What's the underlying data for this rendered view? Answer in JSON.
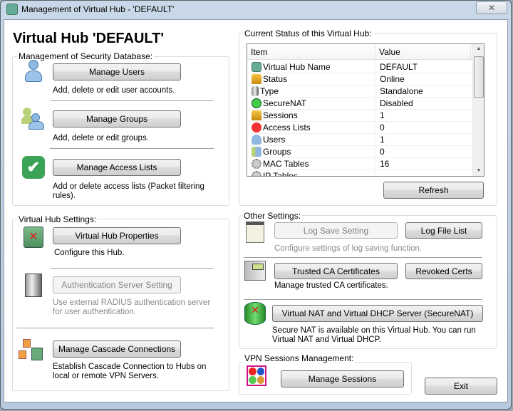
{
  "window": {
    "title": "Management of Virtual Hub - 'DEFAULT'",
    "close_glyph": "✕"
  },
  "hub_title": "Virtual Hub 'DEFAULT'",
  "security": {
    "legend": "Management of Security Database:",
    "users": {
      "button": "Manage Users",
      "desc": "Add, delete or edit user accounts."
    },
    "groups": {
      "button": "Manage Groups",
      "desc": "Add, delete or edit groups."
    },
    "access": {
      "button": "Manage Access Lists",
      "desc": "Add or delete access lists (Packet filtering rules)."
    }
  },
  "hub_settings": {
    "legend": "Virtual Hub Settings:",
    "properties": {
      "button": "Virtual Hub Properties",
      "desc": "Configure this Hub."
    },
    "auth": {
      "button": "Authentication Server Setting",
      "desc": "Use external RADIUS authentication server for user authentication.",
      "disabled": true
    },
    "cascade": {
      "button": "Manage Cascade Connections",
      "desc": "Establish Cascade Connection to Hubs on local or remote VPN Servers."
    }
  },
  "status": {
    "legend": "Current Status of this Virtual Hub:",
    "columns": [
      "Item",
      "Value"
    ],
    "rows": [
      {
        "icon": "hub-icon",
        "item": "Virtual Hub Name",
        "value": "DEFAULT"
      },
      {
        "icon": "session-icon",
        "item": "Status",
        "value": "Online"
      },
      {
        "icon": "server-icon",
        "item": "Type",
        "value": "Standalone"
      },
      {
        "icon": "router-icon",
        "item": "SecureNAT",
        "value": "Disabled"
      },
      {
        "icon": "session-icon",
        "item": "Sessions",
        "value": "1"
      },
      {
        "icon": "stop-icon",
        "item": "Access Lists",
        "value": "0"
      },
      {
        "icon": "user-icon",
        "item": "Users",
        "value": "1"
      },
      {
        "icon": "group-icon",
        "item": "Groups",
        "value": "0"
      },
      {
        "icon": "gear-icon",
        "item": "MAC Tables",
        "value": "16"
      },
      {
        "icon": "gear-icon",
        "item": "IP Tables",
        "value": ""
      }
    ],
    "refresh": "Refresh"
  },
  "other": {
    "legend": "Other Settings:",
    "log_save": "Log Save Setting",
    "log_list": "Log File List",
    "log_desc": "Configure settings of log saving function.",
    "trusted_ca": "Trusted CA Certificates",
    "revoked": "Revoked Certs",
    "ca_desc": "Manage trusted CA certificates.",
    "securenat": "Virtual NAT and Virtual DHCP Server (SecureNAT)",
    "securenat_desc": "Secure NAT is available on this Virtual Hub. You can run Virtual NAT and Virtual DHCP."
  },
  "sessions": {
    "legend": "VPN Sessions Management:",
    "button": "Manage Sessions"
  },
  "exit": "Exit"
}
